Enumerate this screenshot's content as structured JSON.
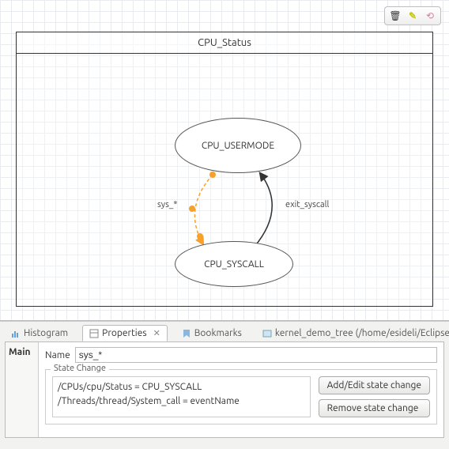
{
  "diagram": {
    "title": "CPU_Status",
    "states": {
      "usermode": "CPU_USERMODE",
      "syscall": "CPU_SYSCALL"
    },
    "transitions": {
      "sys": "sys_*",
      "exit": "exit_syscall"
    }
  },
  "toolbar": {
    "delete": "🗑",
    "edit": "✎",
    "link": "⟲"
  },
  "tabs": {
    "histogram": "Histogram",
    "properties": "Properties",
    "bookmarks": "Bookmarks",
    "kernel": "kernel_demo_tree (/home/esideli/Eclipse-w"
  },
  "panel": {
    "side_tab": "Main",
    "name_label": "Name",
    "name_value": "sys_*",
    "fieldset_title": "State Change",
    "changes": {
      "line1": "/CPUs/cpu/Status = CPU_SYSCALL",
      "line2": "/Threads/thread/System_call = eventName"
    },
    "btn_add": "Add/Edit state change",
    "btn_remove": "Remove state change"
  }
}
